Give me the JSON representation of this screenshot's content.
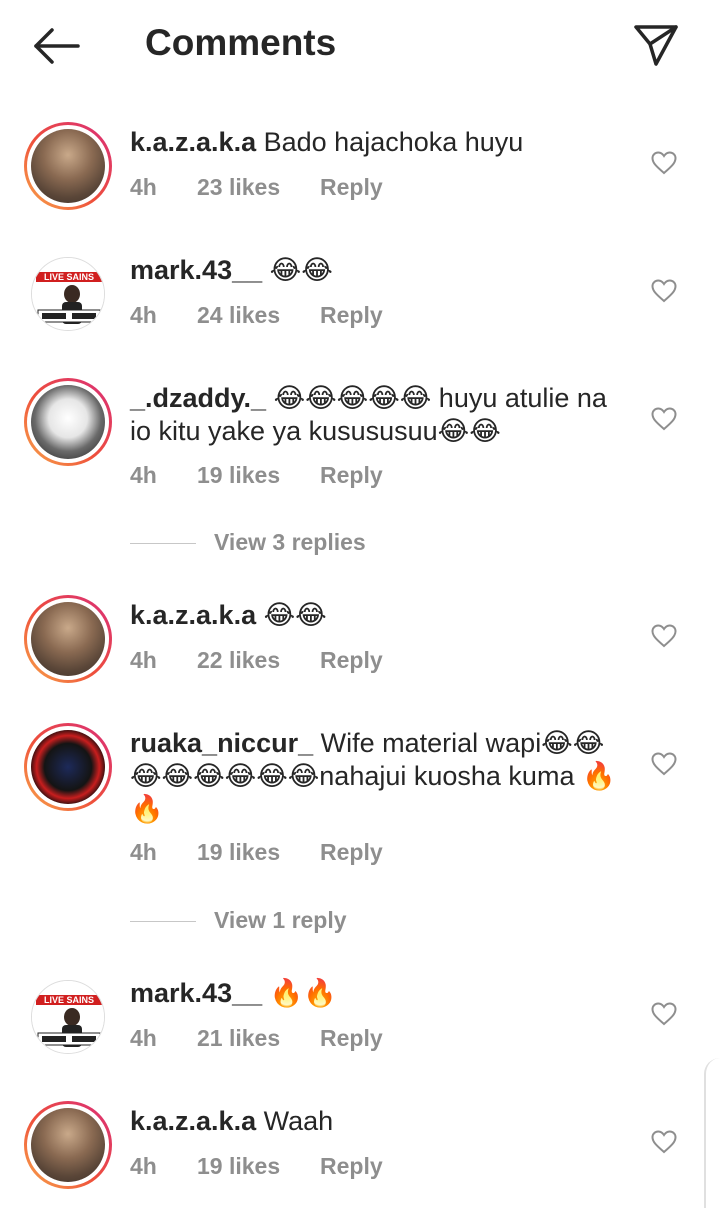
{
  "header": {
    "title": "Comments"
  },
  "comments": [
    {
      "username": "k.a.z.a.k.a",
      "text": "Bado hajachoka huyu",
      "time": "4h",
      "likes": "23 likes",
      "reply": "Reply",
      "avatar": "profile-photo"
    },
    {
      "username": "mark.43__",
      "text": "😂😂",
      "time": "4h",
      "likes": "24 likes",
      "reply": "Reply",
      "avatar": "profile-photo"
    },
    {
      "username": "_.dzaddy._",
      "text": "😂😂😂😂😂 huyu atulie na io kitu yake ya kusususuu😂😂",
      "time": "4h",
      "likes": "19 likes",
      "reply": "Reply",
      "avatar": "profile-photo"
    },
    {
      "username": "k.a.z.a.k.a",
      "text": "😂😂",
      "time": "4h",
      "likes": "22 likes",
      "reply": "Reply",
      "avatar": "profile-photo"
    },
    {
      "username": "ruaka_niccur_",
      "text": "Wife material  wapi😂😂😂😂😂😂😂😂nahajui kuosha kuma 🔥🔥",
      "time": "4h",
      "likes": "19 likes",
      "reply": "Reply",
      "avatar": "profile-photo"
    },
    {
      "username": "mark.43__",
      "text": "🔥🔥",
      "time": "4h",
      "likes": "21 likes",
      "reply": "Reply",
      "avatar": "profile-photo"
    },
    {
      "username": "k.a.z.a.k.a",
      "text": "Waah",
      "time": "4h",
      "likes": "19 likes",
      "reply": "Reply",
      "avatar": "profile-photo"
    }
  ],
  "view_replies": [
    {
      "label": "View 3 replies"
    },
    {
      "label": "View 1 reply"
    }
  ],
  "avatar_text": {
    "mark": "LIVE SAINS"
  },
  "colors": {
    "text": "#262626",
    "meta": "#8e8e8e",
    "story_ring_start": "#f9a94b",
    "story_ring_end": "#d92d7a"
  },
  "icons": {
    "back": "arrow-left-icon",
    "send": "paper-plane-icon",
    "like": "heart-outline-icon"
  }
}
